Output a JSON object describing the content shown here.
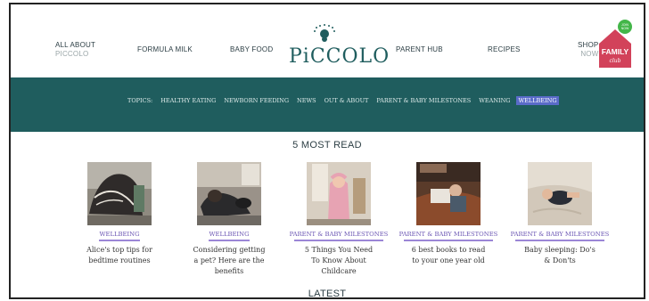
{
  "header": {
    "nav": [
      {
        "label": "ALL ABOUT",
        "sub": "PICCOLO"
      },
      {
        "label": "FORMULA MILK"
      },
      {
        "label": "BABY FOOD"
      },
      {
        "label": "PARENT HUB"
      },
      {
        "label": "RECIPES"
      },
      {
        "label": "SHOP",
        "sub": "NOW"
      }
    ],
    "logo_text": "PiCCOLO",
    "family_club": {
      "badge": "JOIN NOW",
      "line1": "FAMILY",
      "line2": "club"
    }
  },
  "topics": {
    "label": "TOPICS:",
    "items": [
      "HEALTHY EATING",
      "NEWBORN FEEDING",
      "NEWS",
      "OUT & ABOUT",
      "PARENT & BABY MILESTONES",
      "WEANING",
      "WELLBEING"
    ],
    "active": "WELLBEING"
  },
  "most_read": {
    "heading": "5 MOST READ",
    "articles": [
      {
        "category": "WELLBEING",
        "title": "Alice's top tips for bedtime routines"
      },
      {
        "category": "WELLBEING",
        "title": "Considering getting a pet? Here are the benefits"
      },
      {
        "category": "PARENT & BABY MILESTONES",
        "title": "5 Things You Need To Know About Childcare"
      },
      {
        "category": "PARENT & BABY MILESTONES",
        "title": "6 best books to read to your one year old"
      },
      {
        "category": "PARENT & BABY MILESTONES",
        "title": "Baby sleeping: Do's & Don'ts"
      }
    ]
  },
  "latest": {
    "heading": "LATEST"
  },
  "colors": {
    "brand_teal": "#1f5d5e",
    "accent_purple": "#6a55b3",
    "active_topic": "#5a6bc9",
    "family_club_red": "#d2425a",
    "badge_green": "#43b649"
  }
}
